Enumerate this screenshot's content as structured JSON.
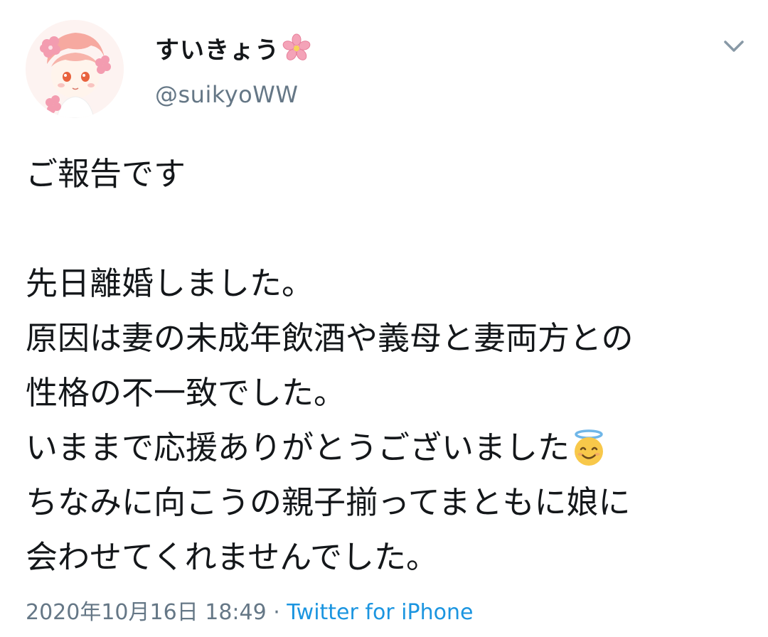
{
  "user": {
    "display_name": "すいきょう",
    "handle": "@suikyoWW",
    "avatar_icon": "avatar-icon",
    "name_emoji": "cherry-blossom-icon"
  },
  "tweet": {
    "lines": [
      "ご報告です",
      "",
      "先日離婚しました。",
      "原因は妻の未成年飲酒や義母と妻両方との",
      "性格の不一致でした。",
      "いままで応援ありがとうございました",
      "ちなみに向こうの親子揃ってまともに娘に",
      "会わせてくれませんでした。"
    ],
    "emoji_after_line_6": "smiling-face-with-halo-icon",
    "timestamp": "2020年10月16日 18:49",
    "separator": " · ",
    "source": "Twitter for iPhone"
  },
  "menu": {
    "icon": "chevron-down-icon"
  },
  "colors": {
    "text": "#14171a",
    "secondary": "#657786",
    "link": "#1b95e0"
  }
}
